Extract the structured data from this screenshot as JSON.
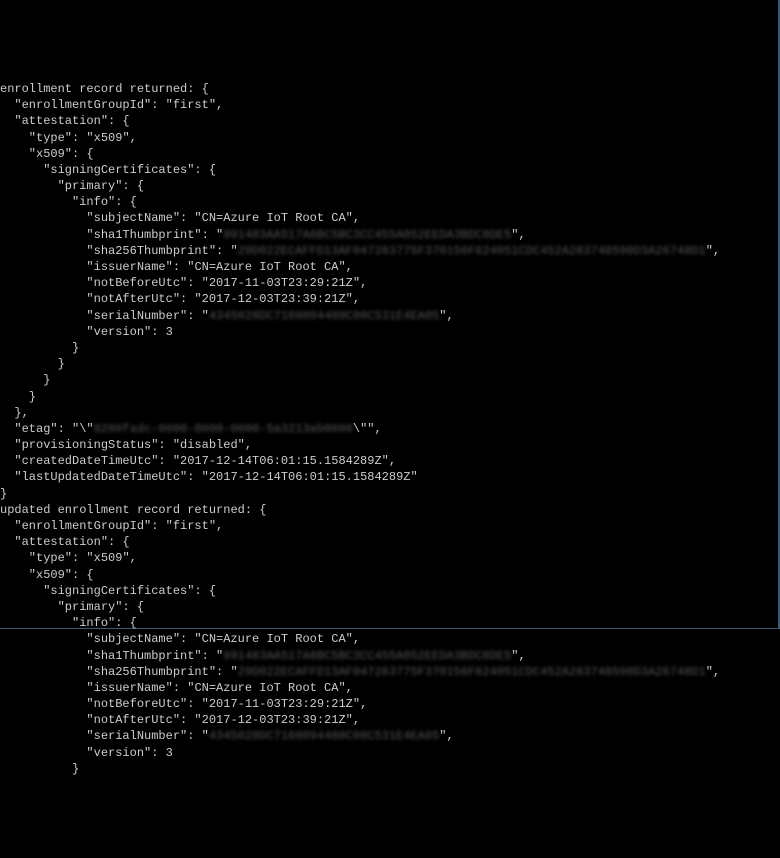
{
  "block1": {
    "header": "enrollment record returned: {",
    "enrollmentGroupId": "first",
    "type": "x509",
    "subjectName": "CN=Azure IoT Root CA",
    "sha1Thumbprint": "991483AA517A6BC5BC3CC455A052EEDA3BDC8DE5",
    "sha256Thumbprint": "29D022ECAFFD13AF047263775F370156F624051CDC452A263748590D3A26748D1",
    "issuerName": "CN=Azure IoT Root CA",
    "notBeforeUtc": "2017-11-03T23:29:21Z",
    "notAfterUtc": "2017-12-03T23:39:21Z",
    "serialNumber": "4345028DC7160094480C00C531E4EA05",
    "version": "3",
    "etagPrefix": "\\\"",
    "etagRedacted": "0200fadc-0000-0000-0000-5a3213ab0000",
    "etagSuffix": "\\\"\",",
    "provisioningStatus": "disabled",
    "createdDateTimeUtc": "2017-12-14T06:01:15.1584289Z",
    "lastUpdatedDateTimeUtc": "2017-12-14T06:01:15.1584289Z"
  },
  "block2": {
    "header": "updated enrollment record returned: {",
    "enrollmentGroupId": "first",
    "type": "x509",
    "subjectName": "CN=Azure IoT Root CA",
    "sha1Thumbprint": "991483AA517A6BC5BC3CC455A052EEDA3BDC8DE5",
    "sha256Thumbprint": "29D022ECAFFD13AF047263775F370156F624051CDC452A263748590D3A26748D1",
    "issuerName": "CN=Azure IoT Root CA",
    "notBeforeUtc": "2017-11-03T23:29:21Z",
    "notAfterUtc": "2017-12-03T23:39:21Z",
    "serialNumber": "4345028DC7160094480C00C531E4EA05",
    "version": "3"
  }
}
